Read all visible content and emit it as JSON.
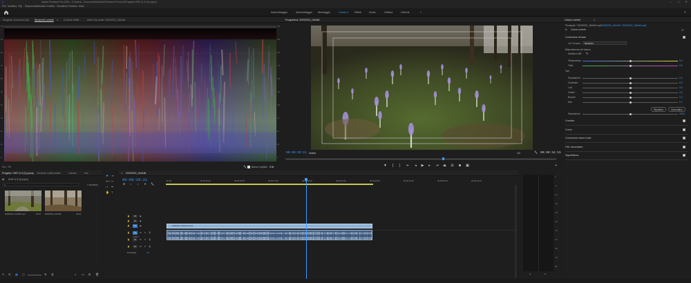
{
  "titlebar": {
    "title": "Adobe Premiere Pro 2020 - C:\\Users\\...\\Documents\\Adobe\\Premiere Pro\\14.0\\Progetto HHR 11.5 (3).prproj *"
  },
  "menu": [
    "File",
    "Modifica",
    "Clip",
    "Sequenza",
    "Marcatori",
    "Grafica",
    "Visualizza",
    "Finestra",
    "Aiuto"
  ],
  "workspaces": {
    "tabs": [
      "Assemblaggio",
      "Assemblaggio",
      "Montaggio",
      "Colore",
      "Effetti",
      "Audio",
      "Grafica",
      "Librerie"
    ],
    "active_index": 3
  },
  "scopes": {
    "tabs": [
      "Sorgente: (nessuna clip)",
      "Strumenti Lumetri",
      "Controlli effetti",
      "Mixer clip audio: 20200202_164446"
    ],
    "active_index": 1,
    "scale_left": [
      "100",
      "90",
      "80",
      "70",
      "60",
      "50",
      "40",
      "30",
      "20",
      "10",
      "0"
    ],
    "scale_right": [
      "255",
      "230",
      "204",
      "178",
      "153",
      "128",
      "102",
      "76",
      "51",
      "25",
      "0"
    ],
    "footer_left": "Rec. 709",
    "clamp_label": "Bianco regolato",
    "bit_depth": "8 bit"
  },
  "program": {
    "tab_label": "Programma: 20200202_164446",
    "timecode_current": "00:00:20:21",
    "fit": "Adatta",
    "zoom": "1/2",
    "timecode_duration": "00:00:34:15"
  },
  "project": {
    "tabs": [
      "Progetto: HHR 11.5 (3).prproj",
      "Browser multimediale",
      "Librerie",
      "Info"
    ],
    "active_index": 0,
    "path": "HHR 11.5 (3).prproj",
    "selection": "1 elemento",
    "items": [
      {
        "name": "20200202_164446.mp4",
        "duration": "34:15"
      },
      {
        "name": "20200202_164446",
        "duration": "34:15"
      }
    ]
  },
  "timeline": {
    "sequence_tab": "20200202_164446",
    "timecode": "00:00:20:21",
    "ruler": [
      "00:00",
      "00:00:04:29",
      "00:00:09:29",
      "00:00:14:29",
      "00:00:19:29",
      "00:00:24:29",
      "00:00:29:29",
      "00:00:34:29",
      "00:00:39:29",
      "00:00:44:29"
    ],
    "tracks_video": [
      "V3",
      "V2",
      "V1"
    ],
    "tracks_audio": [
      "A1",
      "A2",
      "A3"
    ],
    "audio_track_name": "Audio 1",
    "master_label": "Principale",
    "master_value": "0,0",
    "video_clip_name": "20200202_164446.mp4 [V]",
    "playhead_fraction": 0.4
  },
  "meter": {
    "scale": [
      "0",
      "-6",
      "-12",
      "-18",
      "-24",
      "-30",
      "-36",
      "-42",
      "-48",
      "-54",
      "dB"
    ],
    "solo": [
      "S",
      "S"
    ]
  },
  "lumetri": {
    "title": "Colore Lumetri",
    "master": "Principale * 20200202_164446.mp4",
    "clip": "20200202_164446 * 20200202_164446.mp4",
    "effect_name": "Colore Lumetri",
    "section_base": "Correzione di base",
    "lut_label": "LUT di input",
    "lut_value": "Nessuno",
    "wb_group": "Bilanciamento del bianco",
    "wb_picker": "Selettore WB",
    "sliders_wb": [
      {
        "label": "Temperatura",
        "value": "0,0",
        "pos": 0.5
      },
      {
        "label": "Tinta",
        "value": "0,0",
        "pos": 0.5
      }
    ],
    "tone_group": "Toni",
    "sliders_tone": [
      {
        "label": "Esposizione",
        "value": "0,0",
        "pos": 0.5
      },
      {
        "label": "Contrasto",
        "value": "0,0",
        "pos": 0.5
      },
      {
        "label": "Luci",
        "value": "0,0",
        "pos": 0.5
      },
      {
        "label": "Ombre",
        "value": "0,0",
        "pos": 0.5
      },
      {
        "label": "Bianchi",
        "value": "0,0",
        "pos": 0.5
      },
      {
        "label": "Neri",
        "value": "0,0",
        "pos": 0.5
      }
    ],
    "reset_button": "Ripristina",
    "auto_button": "Automatico",
    "saturation_label": "Saturazione",
    "saturation_value": "100,0",
    "sections": [
      "Creativo",
      "Curve",
      "Correzione colore ruote",
      "HSL secondario",
      "Vignettatura"
    ]
  }
}
